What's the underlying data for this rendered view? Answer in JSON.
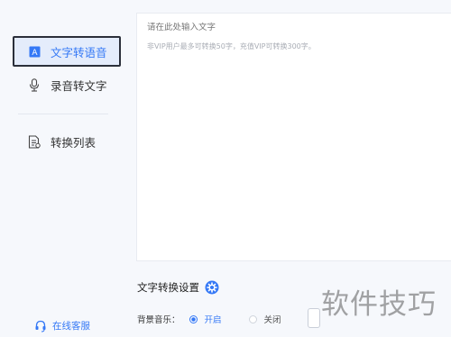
{
  "sidebar": {
    "items": [
      {
        "label": "文字转语音",
        "icon": "text-a-icon",
        "active": true
      },
      {
        "label": "录音转文字",
        "icon": "microphone-icon",
        "active": false
      },
      {
        "label": "转换列表",
        "icon": "document-list-icon",
        "active": false
      }
    ],
    "service_label": "在线客服",
    "service_icon": "headset-icon"
  },
  "editor": {
    "placeholder": "请在此处输入文字",
    "hint": "非VIP用户最多可转换50字，充值VIP可转换300字。"
  },
  "settings": {
    "title": "文字转换设置",
    "title_icon": "gear-icon",
    "bgm_label": "背景音乐：",
    "options": [
      {
        "label": "开启",
        "selected": true
      },
      {
        "label": "关闭",
        "selected": false
      }
    ]
  },
  "watermark": "软件技巧",
  "colors": {
    "accent": "#3478f6",
    "sidebar_bg": "#f6f8fc",
    "active_bg": "#e4ecfb",
    "hint_text": "#a9adb5"
  }
}
